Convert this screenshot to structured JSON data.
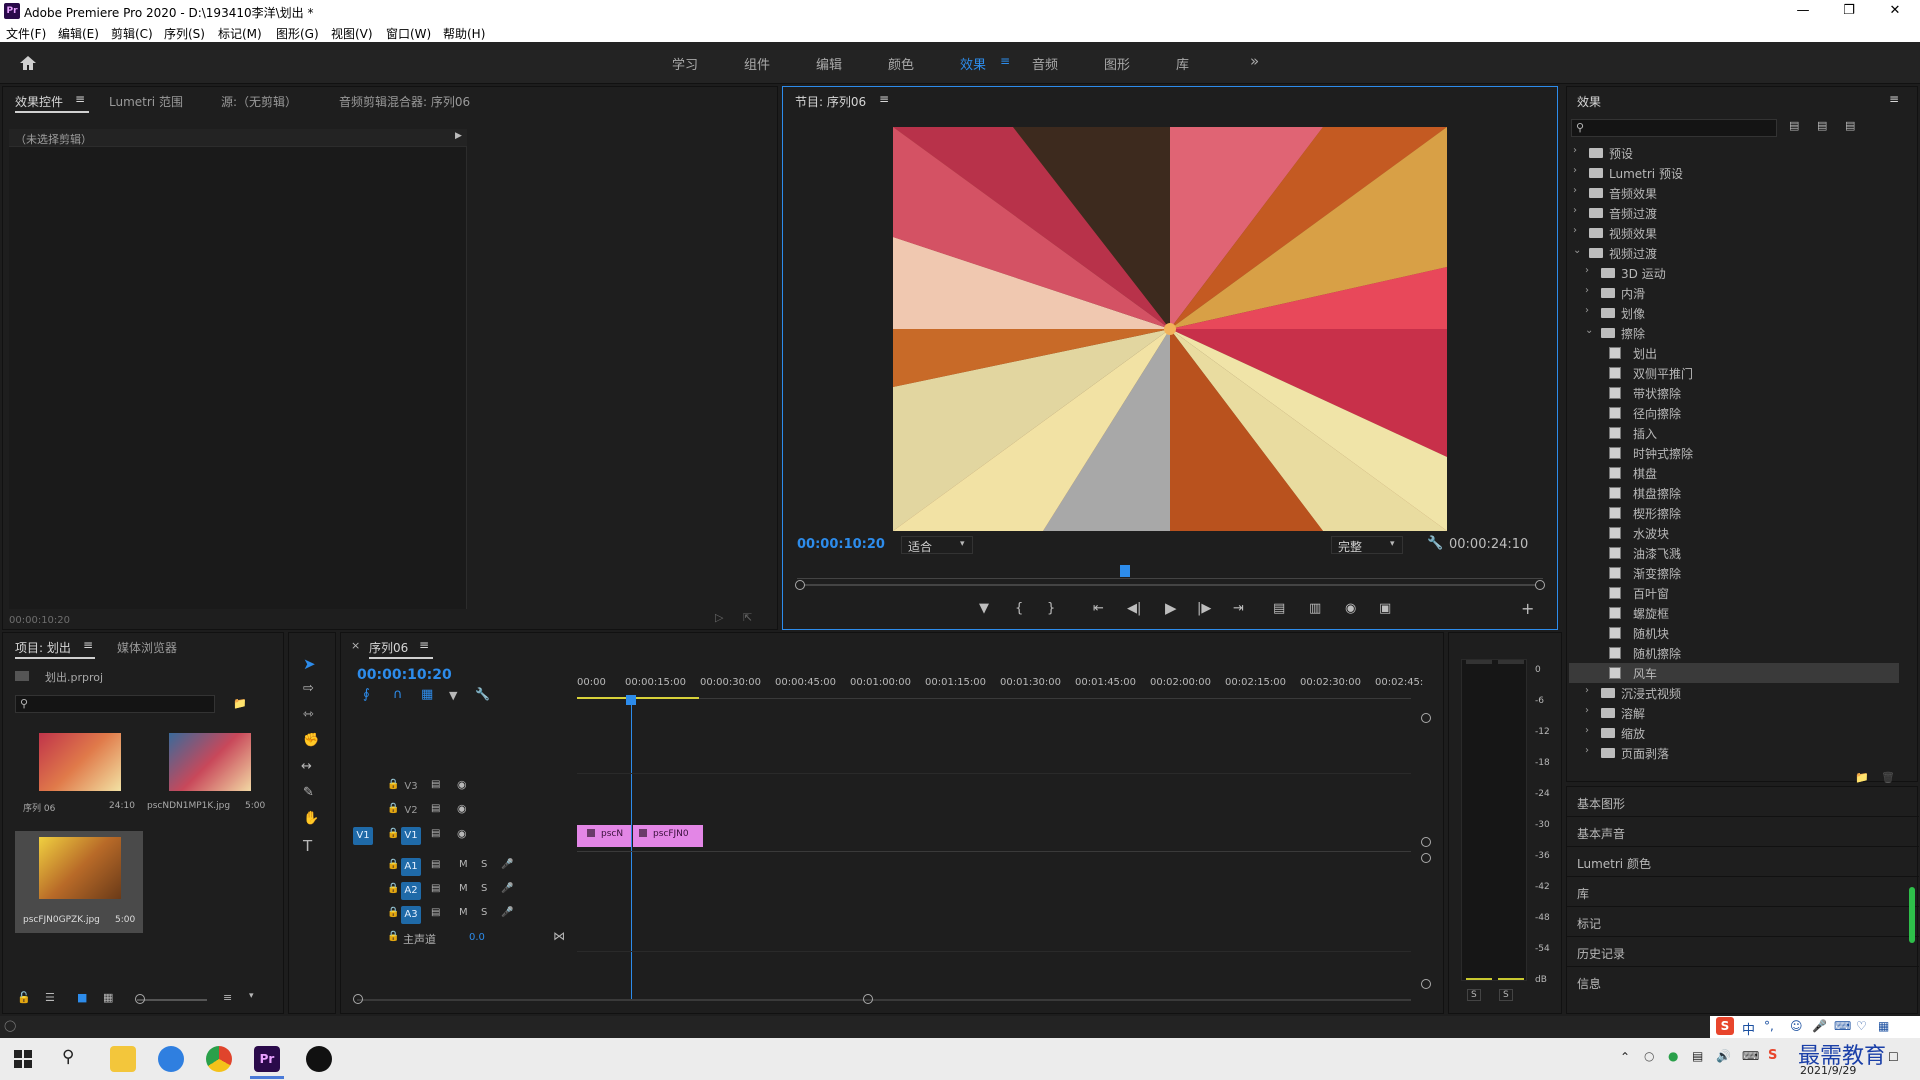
{
  "window": {
    "title": "Adobe Premiere Pro 2020 - D:\\193410李洋\\划出 *",
    "app_icon": "Pr",
    "controls": [
      "minimize-icon",
      "maximize-icon",
      "close-icon"
    ]
  },
  "menu": [
    "文件(F)",
    "编辑(E)",
    "剪辑(C)",
    "序列(S)",
    "标记(M)",
    "图形(G)",
    "视图(V)",
    "窗口(W)",
    "帮助(H)"
  ],
  "workspaces": {
    "items": [
      "学习",
      "组件",
      "编辑",
      "颜色",
      "效果",
      "音频",
      "图形",
      "库"
    ],
    "active": "效果",
    "more": "»"
  },
  "effect_controls": {
    "tabs": [
      "效果控件",
      "Lumetri 范围",
      "源:（无剪辑）",
      "音频剪辑混合器: 序列06"
    ],
    "no_clip": "（未选择剪辑）",
    "timecode": "00:00:10:20"
  },
  "program_monitor": {
    "title": "节目: 序列06",
    "timecode_current": "00:00:10:20",
    "zoom": "适合",
    "quality": "完整",
    "timecode_total": "00:00:24:10",
    "playhead_fraction": 0.44
  },
  "project": {
    "tabs": [
      "项目: 划出",
      "媒体浏览器"
    ],
    "file": "划出.prproj",
    "items": [
      {
        "name": "序列 06",
        "duration": "24:10"
      },
      {
        "name": "pscNDN1MP1K.jpg",
        "duration": "5:00"
      },
      {
        "name": "pscFJN0GPZK.jpg",
        "duration": "5:00"
      }
    ]
  },
  "timeline": {
    "tab": "序列06",
    "timecode": "00:00:10:20",
    "ruler": [
      "00:00",
      "00:00:15:00",
      "00:00:30:00",
      "00:00:45:00",
      "00:01:00:00",
      "00:01:15:00",
      "00:01:30:00",
      "00:01:45:00",
      "00:02:00:00",
      "00:02:15:00",
      "00:02:30:00",
      "00:02:45:"
    ],
    "video_tracks": [
      "V3",
      "V2",
      "V1"
    ],
    "audio_tracks": [
      "A1",
      "A2",
      "A3"
    ],
    "source_patch": "V1",
    "master": {
      "label": "主声道",
      "value": "0.0"
    },
    "clips": [
      "pscN",
      "pscFJN0"
    ]
  },
  "audio_meter": {
    "scale": [
      "0",
      "-6",
      "-12",
      "-18",
      "-24",
      "-30",
      "-36",
      "-42",
      "-48",
      "-54",
      "dB"
    ],
    "solo": [
      "S",
      "S"
    ]
  },
  "effects_panel": {
    "title": "效果",
    "tree": [
      {
        "label": "预设",
        "type": "folder",
        "level": 0,
        "open": false
      },
      {
        "label": "Lumetri 预设",
        "type": "folder",
        "level": 0,
        "open": false
      },
      {
        "label": "音频效果",
        "type": "folder",
        "level": 0,
        "open": false
      },
      {
        "label": "音频过渡",
        "type": "folder",
        "level": 0,
        "open": false
      },
      {
        "label": "视频效果",
        "type": "folder",
        "level": 0,
        "open": false
      },
      {
        "label": "视频过渡",
        "type": "folder",
        "level": 0,
        "open": true
      },
      {
        "label": "3D 运动",
        "type": "folder",
        "level": 1,
        "open": false
      },
      {
        "label": "内滑",
        "type": "folder",
        "level": 1,
        "open": false
      },
      {
        "label": "划像",
        "type": "folder",
        "level": 1,
        "open": false
      },
      {
        "label": "擦除",
        "type": "folder",
        "level": 1,
        "open": true
      },
      {
        "label": "划出",
        "type": "fx",
        "level": 2
      },
      {
        "label": "双侧平推门",
        "type": "fx",
        "level": 2
      },
      {
        "label": "带状擦除",
        "type": "fx",
        "level": 2
      },
      {
        "label": "径向擦除",
        "type": "fx",
        "level": 2
      },
      {
        "label": "插入",
        "type": "fx",
        "level": 2
      },
      {
        "label": "时钟式擦除",
        "type": "fx",
        "level": 2
      },
      {
        "label": "棋盘",
        "type": "fx",
        "level": 2
      },
      {
        "label": "棋盘擦除",
        "type": "fx",
        "level": 2
      },
      {
        "label": "楔形擦除",
        "type": "fx",
        "level": 2
      },
      {
        "label": "水波块",
        "type": "fx",
        "level": 2
      },
      {
        "label": "油漆飞溅",
        "type": "fx",
        "level": 2
      },
      {
        "label": "渐变擦除",
        "type": "fx",
        "level": 2
      },
      {
        "label": "百叶窗",
        "type": "fx",
        "level": 2
      },
      {
        "label": "螺旋框",
        "type": "fx",
        "level": 2
      },
      {
        "label": "随机块",
        "type": "fx",
        "level": 2
      },
      {
        "label": "随机擦除",
        "type": "fx",
        "level": 2
      },
      {
        "label": "风车",
        "type": "fx",
        "level": 2,
        "selected": true
      },
      {
        "label": "沉浸式视频",
        "type": "folder",
        "level": 1,
        "open": false
      },
      {
        "label": "溶解",
        "type": "folder",
        "level": 1,
        "open": false
      },
      {
        "label": "缩放",
        "type": "folder",
        "level": 1,
        "open": false
      },
      {
        "label": "页面剥落",
        "type": "folder",
        "level": 1,
        "open": false
      }
    ],
    "collapsed_panels": [
      "基本图形",
      "基本声音",
      "Lumetri 颜色",
      "库",
      "标记",
      "历史记录",
      "信息"
    ]
  },
  "taskbar": {
    "date": "2021/9/29",
    "ime": "中",
    "watermark": "最需教育"
  },
  "colors": {
    "accent": "#2d8ceb",
    "clip": "#e386e6",
    "panel": "#1e1e1e"
  }
}
